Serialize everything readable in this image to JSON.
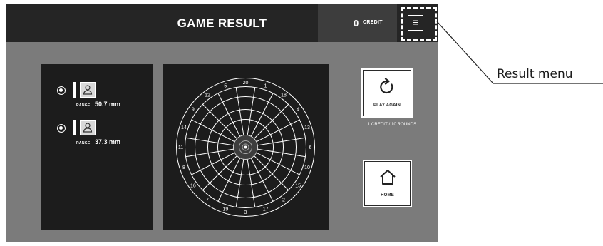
{
  "header": {
    "title": "GAME RESULT",
    "credit_count": "0",
    "credit_label": "CREDIT",
    "menu_icon": "hamburger-menu-icon"
  },
  "players": [
    {
      "range_label": "RANGE",
      "range_value": "50.7 mm",
      "icon": "user-icon"
    },
    {
      "range_label": "RANGE",
      "range_value": "37.3 mm",
      "icon": "user-icon"
    }
  ],
  "dartboard": {
    "numbers": [
      "20",
      "1",
      "18",
      "4",
      "13",
      "6",
      "10",
      "15",
      "2",
      "17",
      "3",
      "19",
      "7",
      "16",
      "8",
      "11",
      "14",
      "9",
      "12",
      "5"
    ]
  },
  "actions": {
    "play_again_label": "PLAY AGAIN",
    "play_again_note": "1 CREDIT / 10 ROUNDS",
    "play_again_icon": "refresh-icon",
    "home_label": "HOME",
    "home_icon": "home-icon"
  },
  "annotation": {
    "label": "Result menu"
  },
  "colors": {
    "background": "#7b7b7b",
    "topbar": "#252525",
    "panel": "#1c1c1c",
    "text": "#ffffff"
  }
}
